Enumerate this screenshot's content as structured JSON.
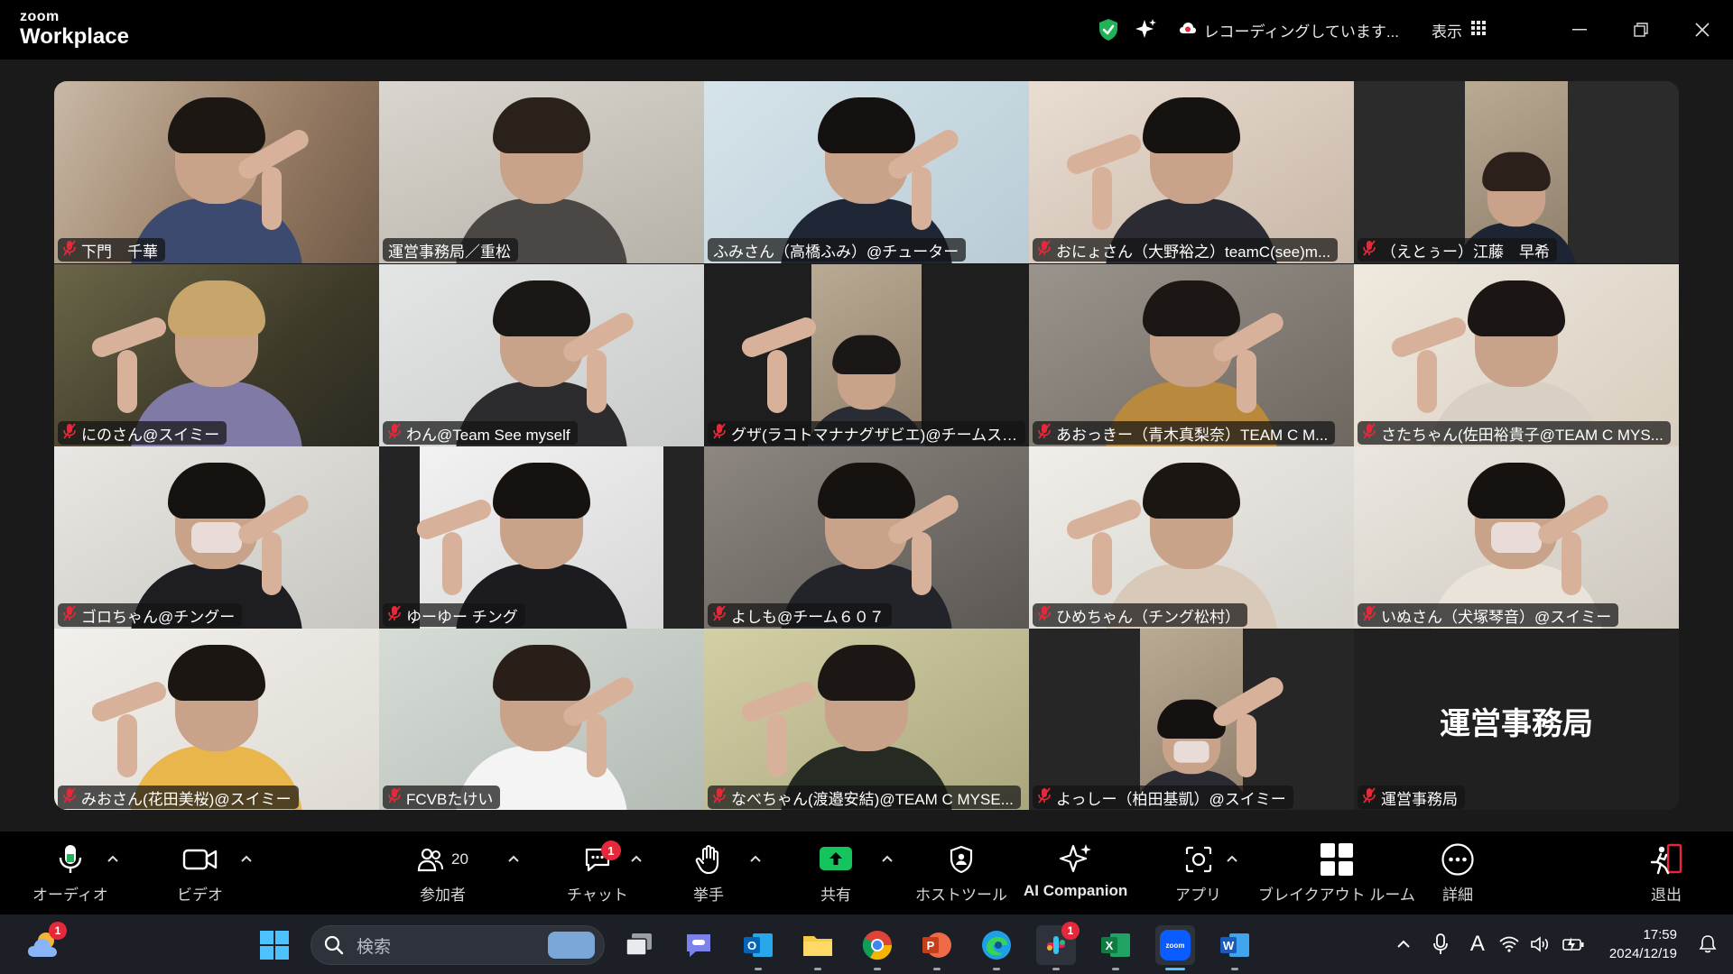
{
  "app": {
    "brand_top": "zoom",
    "brand_bottom": "Workplace"
  },
  "titlebar": {
    "recording_text": "レコーディングしています...",
    "view_label": "表示"
  },
  "grid": {
    "tiles": [
      {
        "name": "下門　千華",
        "muted": true
      },
      {
        "name": "運営事務局／重松",
        "muted": false,
        "active": true
      },
      {
        "name": "ふみさん（高橋ふみ）@チューター",
        "muted": false
      },
      {
        "name": "おにょさん（大野裕之）teamC(see)m...",
        "muted": true
      },
      {
        "name": "（えとぅー）江藤　早希",
        "muted": true
      },
      {
        "name": "にのさん@スイミー",
        "muted": true
      },
      {
        "name": "わん@Team See myself",
        "muted": true
      },
      {
        "name": "グザ(ラコトマナナグザビエ)@チームスイミー",
        "muted": true
      },
      {
        "name": "あおっきー（青木真梨奈）TEAM C M...",
        "muted": true
      },
      {
        "name": "さたちゃん(佐田裕貴子@TEAM C MYS...",
        "muted": true
      },
      {
        "name": "ゴロちゃん@チングー",
        "muted": true
      },
      {
        "name": "ゆーゆー チング",
        "muted": true
      },
      {
        "name": "よしも@チーム６０７",
        "muted": true
      },
      {
        "name": "ひめちゃん（チング松村）",
        "muted": true
      },
      {
        "name": "いぬさん（犬塚琴音）@スイミー",
        "muted": true
      },
      {
        "name": "みおさん(花田美桜)@スイミー",
        "muted": true
      },
      {
        "name": "FCVBたけい",
        "muted": true
      },
      {
        "name": "なべちゃん(渡邉安結)@TEAM C MYSE...",
        "muted": true
      },
      {
        "name": "よっしー（柏田基凱）@スイミー",
        "muted": true
      },
      {
        "name": "運営事務局",
        "muted": true,
        "avatar_text": "運営事務局"
      }
    ]
  },
  "toolbar": {
    "audio": "オーディオ",
    "video": "ビデオ",
    "participants": "参加者",
    "participants_count": "20",
    "chat": "チャット",
    "chat_badge": "1",
    "raise_hand": "挙手",
    "share": "共有",
    "host_tools": "ホストツール",
    "ai_companion": "AI Companion",
    "apps": "アプリ",
    "breakout": "ブレイクアウト ルーム",
    "more": "詳細",
    "leave": "退出"
  },
  "taskbar": {
    "search_placeholder": "検索",
    "weather_badge": "1",
    "slack_badge": "1",
    "time": "17:59",
    "date": "2024/12/19",
    "ime": "A"
  },
  "colors": {
    "active_speaker": "#23d96b",
    "share_green": "#16c45f",
    "badge_red": "#e5293b",
    "mic_off_red": "#e5293b"
  }
}
